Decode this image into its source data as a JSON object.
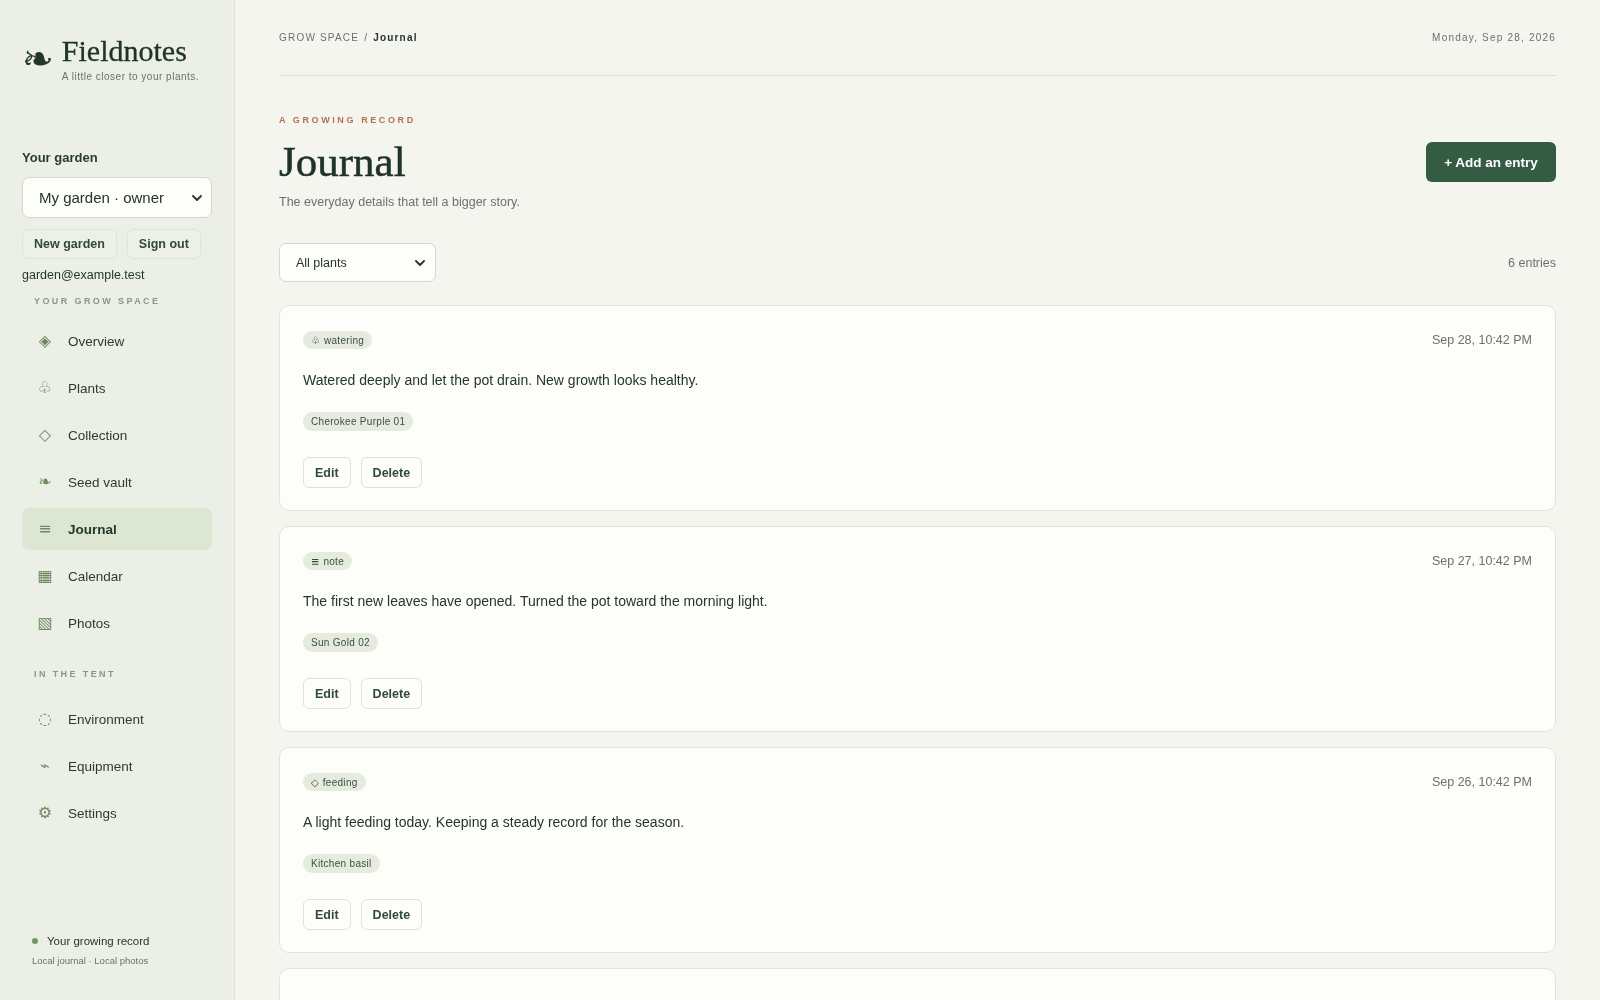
{
  "sidebar": {
    "brand": {
      "icon": "❧",
      "name": "Fieldnotes",
      "tagline": "A little closer to your plants."
    },
    "garden": {
      "label": "Your garden",
      "value": "My garden · owner"
    },
    "buttons": [
      "New garden",
      "Sign out"
    ],
    "email": "garden@example.test",
    "sections": [
      {
        "title": "YOUR GROW SPACE",
        "items": [
          {
            "icon": "◈",
            "label": "Overview",
            "selected": false
          },
          {
            "icon": "♧",
            "label": "Plants",
            "selected": false
          },
          {
            "icon": "◇",
            "label": "Collection",
            "selected": false
          },
          {
            "icon": "❧",
            "label": "Seed vault",
            "selected": false
          },
          {
            "icon": "≡",
            "label": "Journal",
            "selected": true
          },
          {
            "icon": "▦",
            "label": "Calendar",
            "selected": false
          },
          {
            "icon": "▧",
            "label": "Photos",
            "selected": false
          }
        ]
      },
      {
        "title": "IN THE TENT",
        "items": [
          {
            "icon": "◌",
            "label": "Environment",
            "selected": false
          },
          {
            "icon": "⌁",
            "label": "Equipment",
            "selected": false
          },
          {
            "icon": "⚙",
            "label": "Settings",
            "selected": false
          }
        ]
      }
    ],
    "footer": {
      "title": "Your growing record",
      "subtitle": "Local journal · Local photos"
    }
  },
  "topbar": {
    "breadcrumb": {
      "parent": "GROW SPACE",
      "separator": "/",
      "current": "Journal"
    },
    "date": "Monday, Sep 28, 2026"
  },
  "header": {
    "eyebrow": "A GROWING RECORD",
    "title": "Journal",
    "subtitle": "The everyday details that tell a bigger story.",
    "action": "+ Add an entry"
  },
  "filter": {
    "value": "All plants",
    "count": "6 entries"
  },
  "entries": [
    {
      "tag": {
        "icon": "♧",
        "label": "watering"
      },
      "date": "Sep 28, 10:42 PM",
      "text": "Watered deeply and let the pot drain. New growth looks healthy.",
      "plant": "Cherokee Purple 01",
      "actions": [
        "Edit",
        "Delete"
      ]
    },
    {
      "tag": {
        "icon": "≡",
        "label": "note"
      },
      "date": "Sep 27, 10:42 PM",
      "text": "The first new leaves have opened. Turned the pot toward the morning light.",
      "plant": "Sun Gold 02",
      "actions": [
        "Edit",
        "Delete"
      ]
    },
    {
      "tag": {
        "icon": "◇",
        "label": "feeding"
      },
      "date": "Sep 26, 10:42 PM",
      "text": "A light feeding today. Keeping a steady record for the season.",
      "plant": "Kitchen basil",
      "actions": [
        "Edit",
        "Delete"
      ]
    }
  ],
  "more_below": true
}
